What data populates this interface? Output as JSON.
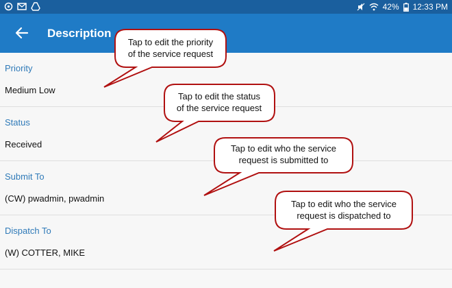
{
  "status_bar": {
    "left_icons": [
      "sync-icon",
      "mail-icon",
      "drive-icon"
    ],
    "battery": "42%",
    "time": "12:33 PM"
  },
  "app_bar": {
    "title": "Description"
  },
  "fields": [
    {
      "label": "Priority",
      "value": "Medium Low"
    },
    {
      "label": "Status",
      "value": "Received"
    },
    {
      "label": "Submit To",
      "value": "(CW) pwadmin, pwadmin"
    },
    {
      "label": "Dispatch To",
      "value": "(W) COTTER, MIKE"
    }
  ],
  "callouts": [
    {
      "line1": "Tap to edit the priority",
      "line2": "of the service request"
    },
    {
      "line1": "Tap to edit the status",
      "line2": "of the service request"
    },
    {
      "line1": "Tap to edit who the service",
      "line2": "request is submitted to"
    },
    {
      "line1": "Tap to edit who the service",
      "line2": "request is dispatched to"
    }
  ],
  "colors": {
    "status_bar": "#1a5f9e",
    "app_bar": "#1f7bc6",
    "label": "#2f7ab8",
    "callout_border": "#b01010"
  }
}
